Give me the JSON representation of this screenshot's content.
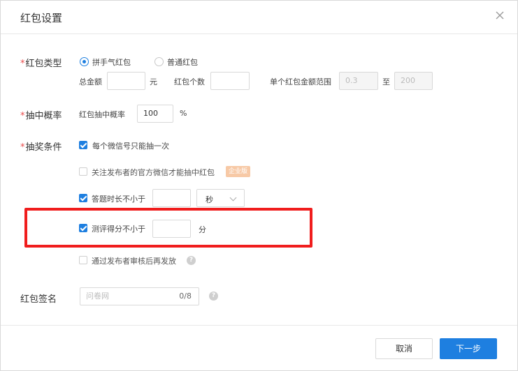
{
  "dialog": {
    "title": "红包设置"
  },
  "red_type": {
    "label": "红包类型",
    "required_mark": "*",
    "options": [
      {
        "label": "拼手气红包",
        "selected": true
      },
      {
        "label": "普通红包",
        "selected": false
      }
    ],
    "total_label": "总金额",
    "total_value": "",
    "total_unit": "元",
    "count_label": "红包个数",
    "count_value": "",
    "range_label": "单个红包金额范围",
    "range_min_placeholder": "0.3",
    "range_sep": "至",
    "range_max_placeholder": "200"
  },
  "probability": {
    "label": "抽中概率",
    "required_mark": "*",
    "field_label": "红包抽中概率",
    "value": "100",
    "unit": "%"
  },
  "conditions": {
    "label": "抽奖条件",
    "required_mark": "*",
    "once_per_wechat": {
      "label": "每个微信号只能抽一次",
      "checked": true
    },
    "follow_official": {
      "label": "关注发布者的官方微信才能抽中红包",
      "checked": false,
      "badge": "企业版"
    },
    "answer_time": {
      "label": "答题时长不小于",
      "checked": true,
      "value": "",
      "unit_selected": "秒"
    },
    "score": {
      "label": "测评得分不小于",
      "checked": true,
      "value": "",
      "unit": "分"
    },
    "review": {
      "label": "通过发布者审核后再发放",
      "checked": false,
      "help": "?"
    }
  },
  "signature": {
    "label": "红包签名",
    "placeholder": "问卷网",
    "counter": "0/8",
    "help": "?"
  },
  "footer": {
    "cancel_label": "取消",
    "next_label": "下一步"
  },
  "colors": {
    "accent": "#1e7fe0",
    "highlight": "#f01d1d",
    "required": "#e94b4b",
    "badge": "#f7c9a6"
  }
}
